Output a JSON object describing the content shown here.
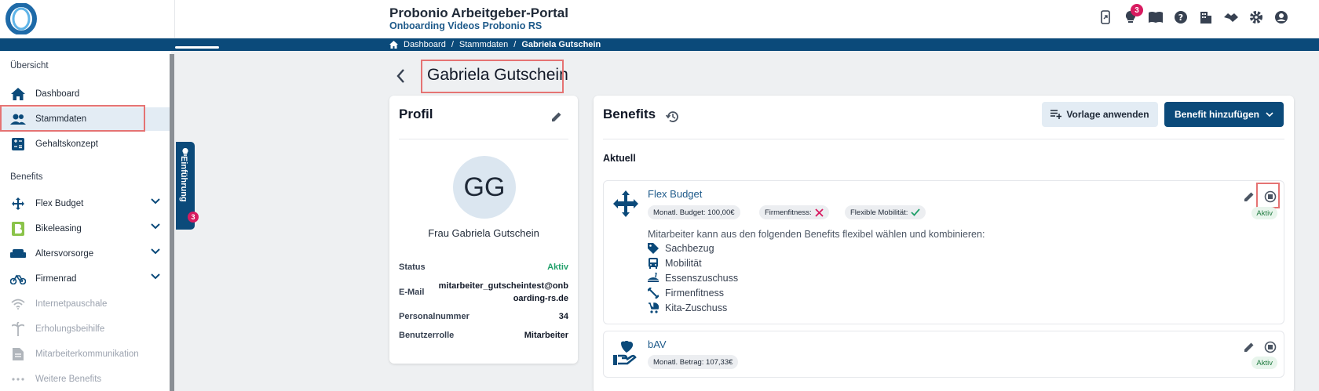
{
  "header": {
    "title": "Probonio Arbeitgeber-Portal",
    "subtitle": "Onboarding Videos Probonio RS",
    "notification_count": "3"
  },
  "breadcrumb": {
    "items": [
      "Dashboard",
      "Stammdaten",
      "Gabriela Gutschein"
    ]
  },
  "sidebar": {
    "section_overview": "Übersicht",
    "section_benefits": "Benefits",
    "items": [
      {
        "label": "Dashboard",
        "icon": "home-icon"
      },
      {
        "label": "Stammdaten",
        "icon": "people-icon"
      },
      {
        "label": "Gehaltskonzept",
        "icon": "calculator-icon"
      },
      {
        "label": "Flex Budget",
        "icon": "arrows-icon"
      },
      {
        "label": "Bikeleasing",
        "icon": "bikeleasing-logo-icon"
      },
      {
        "label": "Altersvorsorge",
        "icon": "sofa-icon"
      },
      {
        "label": "Firmenrad",
        "icon": "bicycle-icon"
      },
      {
        "label": "Internetpauschale",
        "icon": "wifi-icon"
      },
      {
        "label": "Erholungsbeihilfe",
        "icon": "palm-icon"
      },
      {
        "label": "Mitarbeiterkommunikation",
        "icon": "document-icon"
      },
      {
        "label": "Weitere Benefits",
        "icon": "dots-icon"
      }
    ]
  },
  "einfuehrung": {
    "label": "Einführung",
    "count": "3"
  },
  "page": {
    "title": "Gabriela Gutschein"
  },
  "profile": {
    "title": "Profil",
    "initials": "GG",
    "name": "Frau Gabriela Gutschein",
    "status_label": "Status",
    "status_value": "Aktiv",
    "email_label": "E-Mail",
    "email_value_line1": "mitarbeiter_gutscheintest@onb",
    "email_value_line2": "oarding-rs.de",
    "personal_label": "Personalnummer",
    "personal_value": "34",
    "role_label": "Benutzerrolle",
    "role_value": "Mitarbeiter"
  },
  "benefits": {
    "title": "Benefits",
    "template_button": "Vorlage anwenden",
    "add_button": "Benefit hinzufügen",
    "section_current": "Aktuell",
    "flex": {
      "name": "Flex Budget",
      "chip_budget": "Monatl. Budget: 100,00€",
      "chip_fitness": "Firmenfitness:",
      "chip_mobility": "Flexible Mobilität:",
      "status": "Aktiv",
      "description": "Mitarbeiter kann aus den folgenden Benefits flexibel wählen und kombinieren:",
      "sub_items": [
        {
          "label": "Sachbezug",
          "icon": "tag-icon"
        },
        {
          "label": "Mobilität",
          "icon": "bus-icon"
        },
        {
          "label": "Essenszuschuss",
          "icon": "food-icon"
        },
        {
          "label": "Firmenfitness",
          "icon": "fitness-icon"
        },
        {
          "label": "Kita-Zuschuss",
          "icon": "stroller-icon"
        }
      ]
    },
    "bav": {
      "name": "bAV",
      "chip_amount": "Monatl. Betrag: 107,33€",
      "status": "Aktiv"
    }
  },
  "colors": {
    "primary": "#0b4a7a",
    "accent_red": "#d81b60",
    "success": "#22a06b",
    "highlight": "#e57373"
  }
}
